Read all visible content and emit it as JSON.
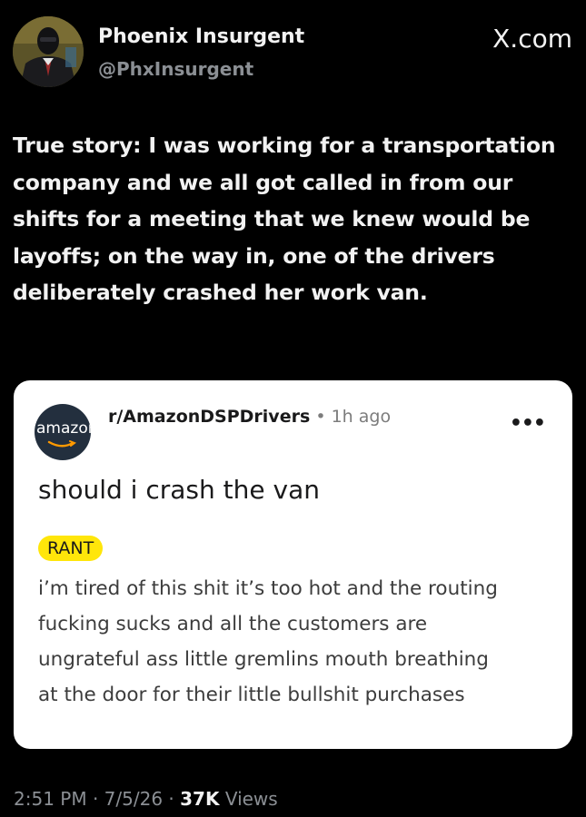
{
  "tweet": {
    "display_name": "Phoenix Insurgent",
    "handle": "@PhxInsurgent",
    "site_mark": "X.com",
    "text": "True story: I was working for a transportation company and we all got called in from our shifts for a meeting that we knew would be layoffs; on the way in, one of the drivers deliberately crashed her work van.",
    "time": "2:51 PM",
    "date": "7/5/26",
    "views_count": "37K",
    "views_label": "Views",
    "separator": "·"
  },
  "embed": {
    "avatar_text": "amazon",
    "subreddit": "r/AmazonDSPDrivers",
    "separator": "•",
    "posted_ago": "1h ago",
    "more_label": "•••",
    "title": "should i crash the van",
    "flair": "RANT",
    "body_lines": [
      "i’m tired of this shit it’s too hot and the routing",
      "fucking sucks and all the customers are",
      "ungrateful ass little gremlins mouth breathing",
      "at the door for their little bullshit purchases"
    ]
  },
  "colors": {
    "background": "#000000",
    "text_primary": "#f2f2f2",
    "text_secondary": "#8b8f94",
    "card_background": "#ffffff",
    "flair_background": "#ffe60a",
    "amazon_dark": "#232f3e",
    "amazon_orange": "#ff9900"
  },
  "icons": {
    "avatar": "profile-photo-masked-person",
    "subreddit_avatar": "amazon-logo",
    "more": "ellipsis-horizontal-icon"
  }
}
